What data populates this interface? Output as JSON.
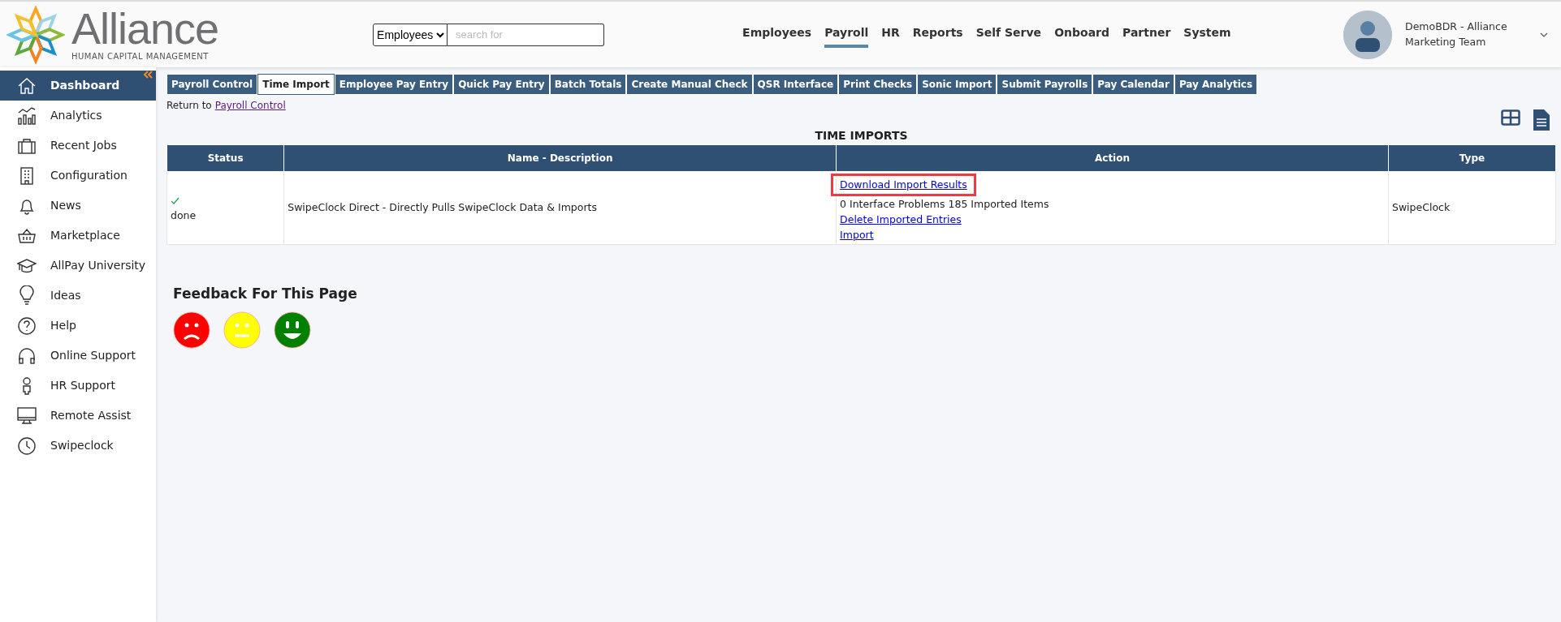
{
  "logo": {
    "name": "Alliance",
    "tagline": "HUMAN CAPITAL MANAGEMENT"
  },
  "search": {
    "scope": "Employees",
    "placeholder": "search for"
  },
  "nav": [
    {
      "label": "Employees",
      "selected": false
    },
    {
      "label": "Payroll",
      "selected": true
    },
    {
      "label": "HR",
      "selected": false
    },
    {
      "label": "Reports",
      "selected": false
    },
    {
      "label": "Self Serve",
      "selected": false
    },
    {
      "label": "Onboard",
      "selected": false
    },
    {
      "label": "Partner",
      "selected": false
    },
    {
      "label": "System",
      "selected": false
    }
  ],
  "user": {
    "name": "DemoBDR - Alliance Marketing Team"
  },
  "sidebar": {
    "items": [
      {
        "label": "Dashboard",
        "selected": true
      },
      {
        "label": "Analytics",
        "selected": false
      },
      {
        "label": "Recent Jobs",
        "selected": false
      },
      {
        "label": "Configuration",
        "selected": false
      },
      {
        "label": "News",
        "selected": false
      },
      {
        "label": "Marketplace",
        "selected": false
      },
      {
        "label": "AllPay University",
        "selected": false
      },
      {
        "label": "Ideas",
        "selected": false
      },
      {
        "label": "Help",
        "selected": false
      },
      {
        "label": "Online Support",
        "selected": false
      },
      {
        "label": "HR Support",
        "selected": false
      },
      {
        "label": "Remote Assist",
        "selected": false
      },
      {
        "label": "Swipeclock",
        "selected": false
      }
    ]
  },
  "tabs": [
    {
      "label": "Payroll Control",
      "selected": false
    },
    {
      "label": "Time Import",
      "selected": true
    },
    {
      "label": "Employee Pay Entry",
      "selected": false
    },
    {
      "label": "Quick Pay Entry",
      "selected": false
    },
    {
      "label": "Batch Totals",
      "selected": false
    },
    {
      "label": "Create Manual Check",
      "selected": false
    },
    {
      "label": "QSR Interface",
      "selected": false
    },
    {
      "label": "Print Checks",
      "selected": false
    },
    {
      "label": "Sonic Import",
      "selected": false
    },
    {
      "label": "Submit Payrolls",
      "selected": false
    },
    {
      "label": "Pay Calendar",
      "selected": false
    },
    {
      "label": "Pay Analytics",
      "selected": false
    }
  ],
  "return": {
    "text": "Return to",
    "link": "Payroll Control"
  },
  "table": {
    "title": "TIME IMPORTS",
    "columns": [
      "Status",
      "Name - Description",
      "Action",
      "Type"
    ],
    "rows": [
      {
        "status": "done",
        "done": true,
        "name": "SwipeClock Direct - Directly Pulls SwipeClock Data & Imports",
        "actions": [
          {
            "kind": "link",
            "text": "Download Import Results",
            "highlighted": true
          },
          {
            "kind": "text",
            "text": "0 Interface Problems 185 Imported Items",
            "highlighted": false
          },
          {
            "kind": "link",
            "text": "Delete Imported Entries",
            "highlighted": false
          },
          {
            "kind": "link",
            "text": "Import",
            "highlighted": false
          }
        ],
        "type": "SwipeClock"
      }
    ]
  },
  "feedback": {
    "title": "Feedback For This Page",
    "faces": [
      {
        "kind": "sad",
        "color": "#ff0000"
      },
      {
        "kind": "neutral",
        "color": "#ffff00"
      },
      {
        "kind": "happy",
        "color": "#008000"
      }
    ]
  }
}
